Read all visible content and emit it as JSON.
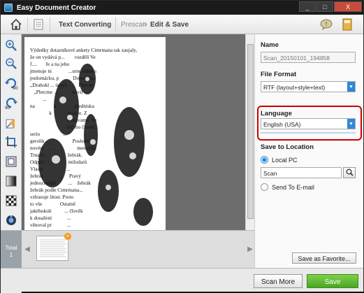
{
  "window": {
    "title": "Easy Document Creator",
    "minimize": "_",
    "maximize": "□",
    "close": "X"
  },
  "breadcrumb": {
    "step1": "Text Converting",
    "step2": "Prescan",
    "sep": ">",
    "step3": "Edit & Save"
  },
  "sidebar": {
    "rotate_left_label": "90",
    "rotate_right_label": "90"
  },
  "document": {
    "lines": [
      "Výdedky dotazníkové ankety Cimrmana tak zaujaly,",
      "že on vydává p...        rozdělí Ve",
      "f....       ře a na jeho",
      "jmenuje ni             ...urnu tabáku",
      "podomácku, p           Domovina.",
      "„Drahokl ... úderů         Pletcm",
      "   „Pletcme ...           stavil",
      "          ...               ...",
      "na               k              předniska",
      "               k             kostce. Z",
      "                             Pestávame. Ve",
      "                             ničeho časem\".",
      "serio                  ...",
      "gerolik                      Posledni",
      "novém    ...                   metodiku",
      "Trnavy                  žebrák.",
      "Odpírá      ...          milodarů",
      "Vlasty                  ...",
      "žebrák            ...     Pravý",
      "jednoznačně          ...    žebrák",
      "žebrák podle Cimrmana...",
      "vzbuzuje lítost. Proto",
      "to vše              Ostatně",
      "jakéhokoli          ... člověk",
      "k dosažení            ...",
      "věnoval pr            ...",
      "ale dnes            ...",
      "k, persán apod.  Odmítal i se...",
      "bezruké mrzáky jako nepřesvědčivé, protože mu"
    ],
    "total_label": "Total",
    "total_count": "1"
  },
  "panel": {
    "name_label": "Name",
    "name_value": "Scan_20150101_194858",
    "format_label": "File Format",
    "format_value": "RTF (layout+style+text)",
    "language_label": "Language",
    "language_value": "English (USA)",
    "save_location_label": "Save to Location",
    "local_pc_label": "Local PC",
    "folder_value": "Scan",
    "email_label": "Send To E-mail",
    "favorite_button": "Save as Favorite..."
  },
  "footer": {
    "scan_more": "Scan More",
    "save": "Save"
  },
  "colors": {
    "accent": "#2f88d8",
    "save_green": "#5cb82e",
    "highlight": "#cc0000"
  }
}
